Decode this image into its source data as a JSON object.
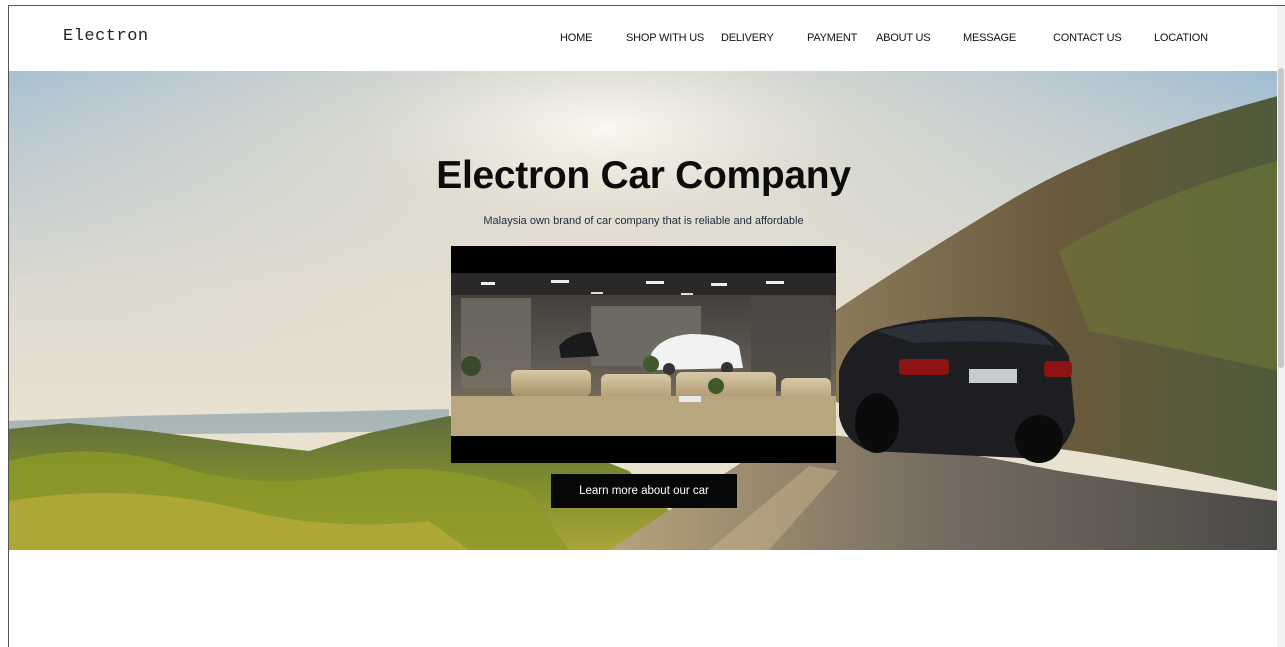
{
  "brand": {
    "name": "Electron"
  },
  "nav": {
    "items": [
      {
        "label": "HOME"
      },
      {
        "label": "SHOP WITH US"
      },
      {
        "label": "DELIVERY"
      },
      {
        "label": "PAYMENT"
      },
      {
        "label": "ABOUT US"
      },
      {
        "label": "MESSAGE"
      },
      {
        "label": "CONTACT US"
      },
      {
        "label": "LOCATION"
      }
    ]
  },
  "hero": {
    "title": "Electron Car Company",
    "subtitle": "Malaysia own brand of car company that is reliable and affordable",
    "cta_label": "Learn more about our car"
  },
  "colors": {
    "cta_background": "#080808",
    "nav_text": "#111111",
    "subtitle_text": "#1e2a44"
  }
}
